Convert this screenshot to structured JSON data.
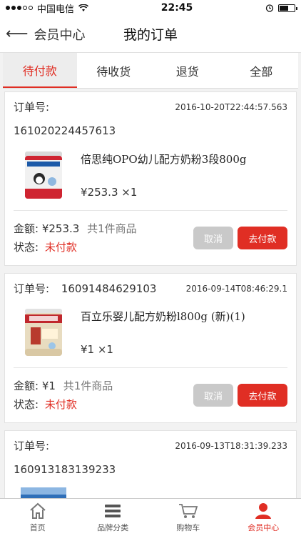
{
  "status": {
    "carrier": "中国电信",
    "time": "22:45"
  },
  "nav": {
    "back_label": "会员中心",
    "title": "我的订单"
  },
  "tabs": [
    {
      "label": "待付款",
      "active": true
    },
    {
      "label": "待收货",
      "active": false
    },
    {
      "label": "退货",
      "active": false
    },
    {
      "label": "全部",
      "active": false
    }
  ],
  "labels": {
    "order_no": "订单号:",
    "amount": "金额:",
    "status": "状态:",
    "cancel": "取消",
    "pay": "去付款"
  },
  "orders": [
    {
      "order_no": "161020224457613",
      "time": "2016-10-20T22:44:57.563",
      "product_name": "倍思纯OPO幼儿配方奶粉3段800g",
      "unit_price": "¥253.3 ×1",
      "amount": "¥253.3",
      "count_text": "共1件商品",
      "status": "未付款"
    },
    {
      "order_no": "16091484629103",
      "time": "2016-09-14T08:46:29.1",
      "product_name": "百立乐婴儿配方奶粉l800g (新)(1)",
      "unit_price": "¥1 ×1",
      "amount": "¥1",
      "count_text": "共1件商品",
      "status": "未付款"
    },
    {
      "order_no": "160913183139233",
      "time": "2016-09-13T18:31:39.233"
    }
  ],
  "tabbar": [
    {
      "label": "首页",
      "icon": "home-icon",
      "active": false
    },
    {
      "label": "品牌分类",
      "icon": "menu-icon",
      "active": false
    },
    {
      "label": "购物车",
      "icon": "cart-icon",
      "active": false
    },
    {
      "label": "会员中心",
      "icon": "person-icon",
      "active": true
    }
  ],
  "colors": {
    "accent": "#e02e24",
    "cancel_bg": "#c9c9c9"
  }
}
